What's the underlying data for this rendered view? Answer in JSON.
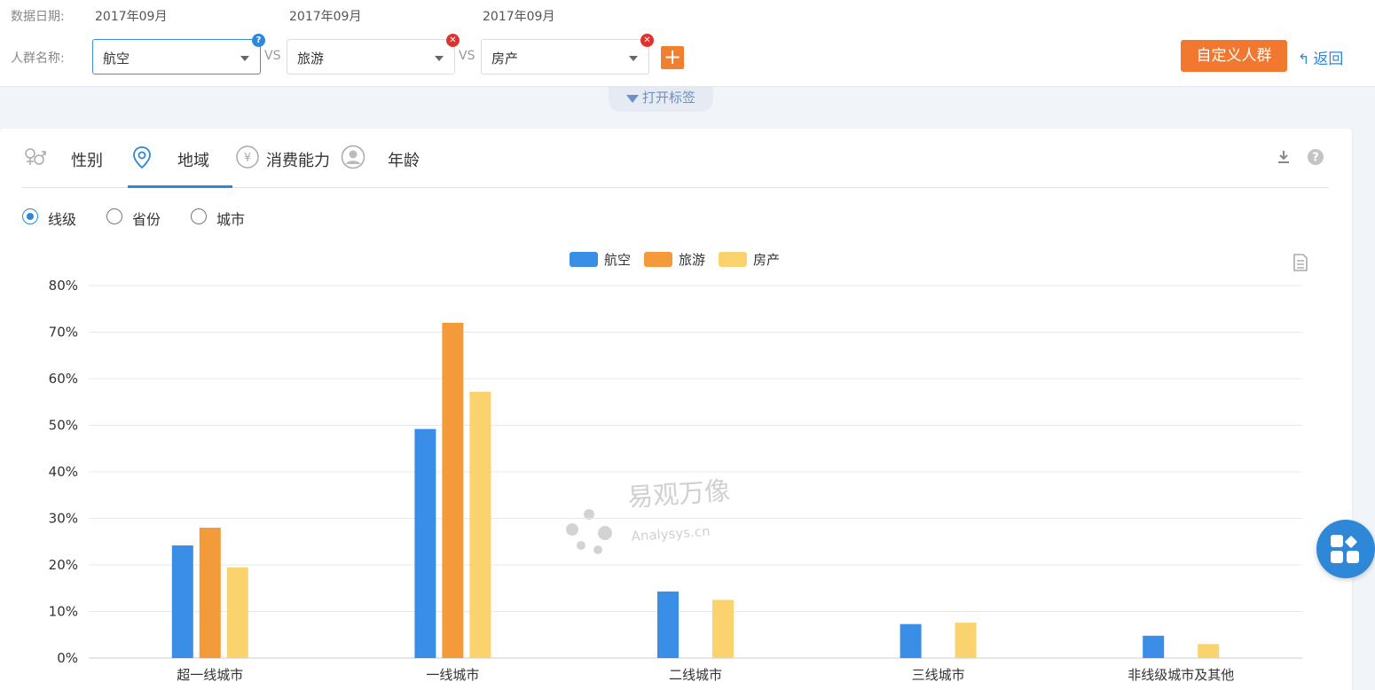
{
  "filter": {
    "date_label": "数据日期:",
    "dates": [
      "2017年09月",
      "2017年09月",
      "2017年09月"
    ],
    "group_label": "人群名称:",
    "vs_label": "VS",
    "groups": [
      "航空",
      "旅游",
      "房产"
    ],
    "add_label": "+",
    "custom_button": "自定义人群",
    "back_label": "返回",
    "help_badge": "?",
    "remove_badge": "✕"
  },
  "open_tag_label": "打开标签",
  "tabs": [
    {
      "label": "性别",
      "icon": "gender-icon"
    },
    {
      "label": "地域",
      "icon": "location-pin-icon",
      "active": true
    },
    {
      "label": "消费能力",
      "icon": "yuan-coin-icon"
    },
    {
      "label": "年龄",
      "icon": "person-icon"
    }
  ],
  "radios": [
    {
      "label": "线级",
      "checked": true
    },
    {
      "label": "省份",
      "checked": false
    },
    {
      "label": "城市",
      "checked": false
    }
  ],
  "watermark": {
    "cn": "易观万像",
    "en": "Analysys.cn"
  },
  "colors": {
    "accent": "#2f87d8",
    "orange_button": "#f2772f"
  },
  "chart_data": {
    "type": "bar",
    "categories": [
      "超一线城市",
      "一线城市",
      "二线城市",
      "三线城市",
      "非线级城市及其他"
    ],
    "series": [
      {
        "name": "航空",
        "color": "#3a8ee6",
        "values": [
          24.2,
          49.2,
          14.3,
          7.3,
          4.8
        ]
      },
      {
        "name": "旅游",
        "color": "#f39a3a",
        "values": [
          28.0,
          72.0,
          0,
          0,
          0
        ]
      },
      {
        "name": "房产",
        "color": "#fad36f",
        "values": [
          19.5,
          57.2,
          12.5,
          7.6,
          3.0
        ]
      }
    ],
    "yticks": [
      "0%",
      "10%",
      "20%",
      "30%",
      "40%",
      "50%",
      "60%",
      "70%",
      "80%"
    ],
    "ylim": [
      0,
      80
    ],
    "legend_position": "top-center",
    "grid": true
  }
}
